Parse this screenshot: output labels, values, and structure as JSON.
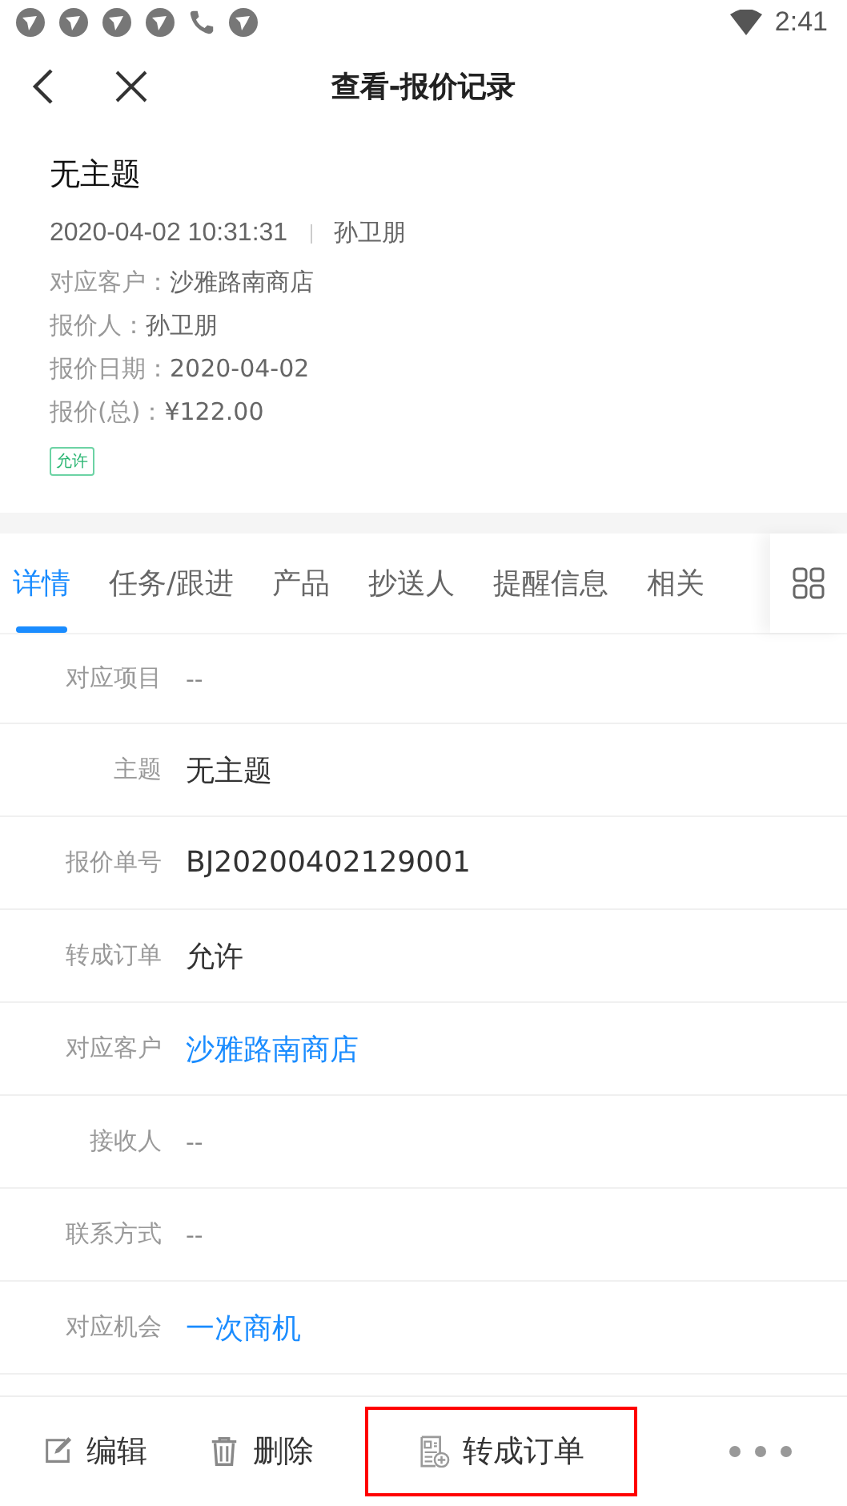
{
  "status_bar": {
    "notifications": [
      {
        "kind": "app"
      },
      {
        "kind": "app"
      },
      {
        "kind": "app"
      },
      {
        "kind": "app"
      },
      {
        "kind": "phone"
      },
      {
        "kind": "app"
      }
    ],
    "time": "2:41"
  },
  "nav": {
    "title": "查看-报价记录"
  },
  "header": {
    "title": "无主题",
    "datetime": "2020-04-02 10:31:31",
    "author": "孙卫朋",
    "fields": [
      {
        "label": "对应客户：",
        "value": "沙雅路南商店"
      },
      {
        "label": "报价人：",
        "value": "孙卫朋"
      },
      {
        "label": "报价日期：",
        "value": "2020-04-02"
      },
      {
        "label": "报价(总)：",
        "value": "¥122.00"
      }
    ],
    "tag": "允许"
  },
  "tabs": [
    {
      "label": "详情",
      "selected": true
    },
    {
      "label": "任务/跟进",
      "selected": false
    },
    {
      "label": "产品",
      "selected": false
    },
    {
      "label": "抄送人",
      "selected": false
    },
    {
      "label": "提醒信息",
      "selected": false
    },
    {
      "label": "相关",
      "selected": false
    }
  ],
  "details": [
    {
      "label": "对应项目",
      "value": "--",
      "kind": "empty"
    },
    {
      "label": "主题",
      "value": "无主题",
      "kind": "text"
    },
    {
      "label": "报价单号",
      "value": "BJ20200402129001",
      "kind": "text"
    },
    {
      "label": "转成订单",
      "value": "允许",
      "kind": "text"
    },
    {
      "label": "对应客户",
      "value": "沙雅路南商店",
      "kind": "link"
    },
    {
      "label": "接收人",
      "value": "--",
      "kind": "empty"
    },
    {
      "label": "联系方式",
      "value": "--",
      "kind": "empty"
    },
    {
      "label": "对应机会",
      "value": "一次商机",
      "kind": "link"
    }
  ],
  "actions": [
    {
      "label": "编辑",
      "kind": "edit",
      "highlighted": false
    },
    {
      "label": "删除",
      "kind": "delete",
      "highlighted": false
    },
    {
      "label": "转成订单",
      "kind": "convert",
      "highlighted": true
    }
  ]
}
